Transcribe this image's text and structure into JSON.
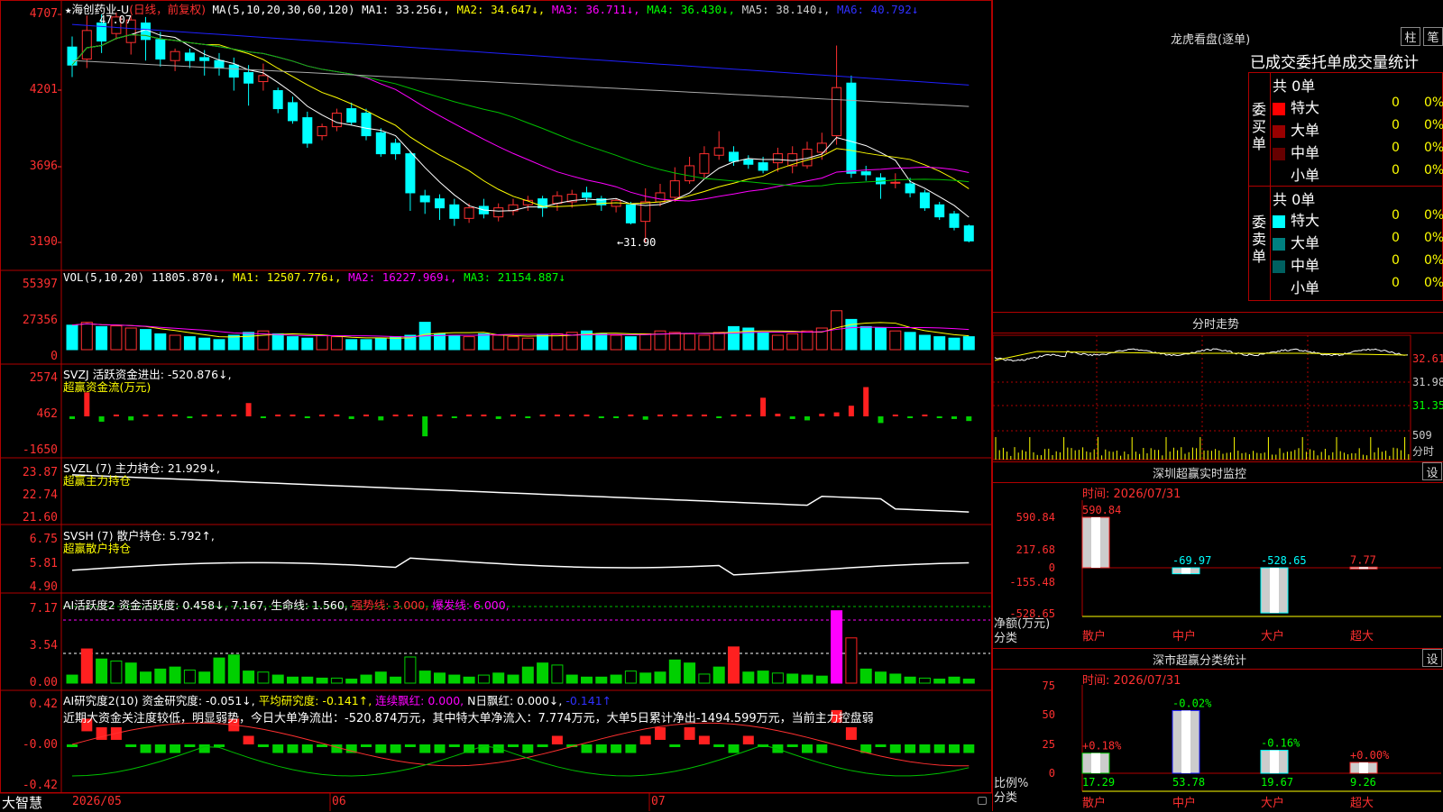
{
  "header": {
    "star": "★",
    "stock_name": "海创药业-U",
    "period": "(日线，前复权)",
    "ma_label": "MA(5,10,20,30,60,120)",
    "ma1": "MA1: 33.256↓,",
    "ma2": "MA2: 34.647↓,",
    "ma3": "MA3: 36.711↓,",
    "ma4": "MA4: 36.430↓,",
    "ma5": "MA5: 38.140↓,",
    "ma6": "MA6: 40.792↓"
  },
  "main_axis": [
    "4707",
    "4201",
    "3696",
    "3190"
  ],
  "price_marks": {
    "high": "47.07",
    "low": "←31.90"
  },
  "vol": {
    "label": "VOL(5,10,20)",
    "value": "11805.870↓,",
    "ma1": "MA1: 12507.776↓,",
    "ma2": "MA2: 16227.969↓,",
    "ma3": "MA3: 21154.887↓",
    "axis": [
      "55397",
      "27356",
      "0"
    ]
  },
  "svzj": {
    "label": "SVZJ  活跃资金进出: -520.876↓,",
    "sub": "超赢资金流(万元)",
    "axis": [
      "2574",
      "462",
      "-1650"
    ]
  },
  "svzl": {
    "label": "SVZL (7) 主力持仓: 21.929↓,",
    "sub": "超赢主力持仓",
    "axis": [
      "23.87",
      "22.74",
      "21.60"
    ]
  },
  "svsh": {
    "label": "SVSH (7) 散户持仓: 5.792↑,",
    "sub": "超赢散户持仓",
    "axis": [
      "6.75",
      "5.81",
      "4.90"
    ]
  },
  "ai_active": {
    "label": "AI活跃度2 资金活跃度: 0.458↓,",
    "v2": "7.167,",
    "life": "生命线: 1.560,",
    "strong": "强势线: 3.000,",
    "burst": "爆发线: 6.000,",
    "axis": [
      "7.17",
      "3.54",
      "0.00"
    ]
  },
  "ai_research": {
    "label": "AI研究度2(10) 资金研究度: -0.051↓,",
    "avg": "平均研究度: -0.141↑,",
    "cont": "连续飘红: 0.000,",
    "n": "N日飘红: 0.000↓,",
    "last": "-0.141↑",
    "note": "近期大资金关注度较低，明显弱势，今日大单净流出：-520.874万元，其中特大单净流入：7.774万元，大单5日累计净出-1494.599万元，当前主力控盘弱",
    "axis": [
      "0.42",
      "-0.00",
      "-0.42"
    ]
  },
  "bottom_bar": {
    "brand": "大智慧",
    "d1": "2026/05",
    "d2": "06",
    "d3": "07"
  },
  "dragon": {
    "title": "龙虎看盘(逐单)",
    "btn1": "柱",
    "btn2": "笔",
    "tabs": "已成交委托单成交量统计",
    "buy_total": "共 0单",
    "sell_total": "共 0单",
    "buy_side": "委买单",
    "sell_side": "委卖单",
    "buy_rows": [
      {
        "label": "特大",
        "v": "0",
        "p": "0%",
        "color": "#ff0000"
      },
      {
        "label": "大单",
        "v": "0",
        "p": "0%",
        "color": "#990000"
      },
      {
        "label": "中单",
        "v": "0",
        "p": "0%",
        "color": "#660000"
      },
      {
        "label": "小单",
        "v": "0",
        "p": "0%",
        "color": "#000000"
      }
    ],
    "sell_rows": [
      {
        "label": "特大",
        "v": "0",
        "p": "0%",
        "color": "#00ffff"
      },
      {
        "label": "大单",
        "v": "0",
        "p": "0%",
        "color": "#008080"
      },
      {
        "label": "中单",
        "v": "0",
        "p": "0%",
        "color": "#006060"
      },
      {
        "label": "小单",
        "v": "0",
        "p": "0%",
        "color": "#000000"
      }
    ]
  },
  "intraday": {
    "title": "分时走势",
    "p1": "32.61",
    "p2": "31.98",
    "p3": "31.35",
    "vol": "509",
    "unit": "分时"
  },
  "sz_monitor": {
    "title": "深圳超赢实时监控",
    "btn": "设",
    "time": "时间: 2026/07/31",
    "axis": [
      "590.84",
      "217.68",
      "0",
      "-155.48",
      "-528.65"
    ],
    "unit1": "净额(万元)",
    "unit2": "分类",
    "bars": [
      {
        "label": "散户",
        "value": "590.84"
      },
      {
        "label": "中户",
        "value": "-69.97"
      },
      {
        "label": "大户",
        "value": "-528.65"
      },
      {
        "label": "超大",
        "value": "7.77"
      }
    ]
  },
  "sz_class": {
    "title": "深市超赢分类统计",
    "btn": "设",
    "time": "时间: 2026/07/31",
    "axis": [
      "75",
      "50",
      "25",
      "0"
    ],
    "unit1": "比例%",
    "unit2": "分类",
    "bars": [
      {
        "label": "散户",
        "value": "17.29",
        "delta": "+0.18%"
      },
      {
        "label": "中户",
        "value": "53.78",
        "delta": "-0.02%"
      },
      {
        "label": "大户",
        "value": "19.67",
        "delta": "-0.16%"
      },
      {
        "label": "超大",
        "value": "9.26",
        "delta": "+0.00%"
      }
    ]
  }
}
